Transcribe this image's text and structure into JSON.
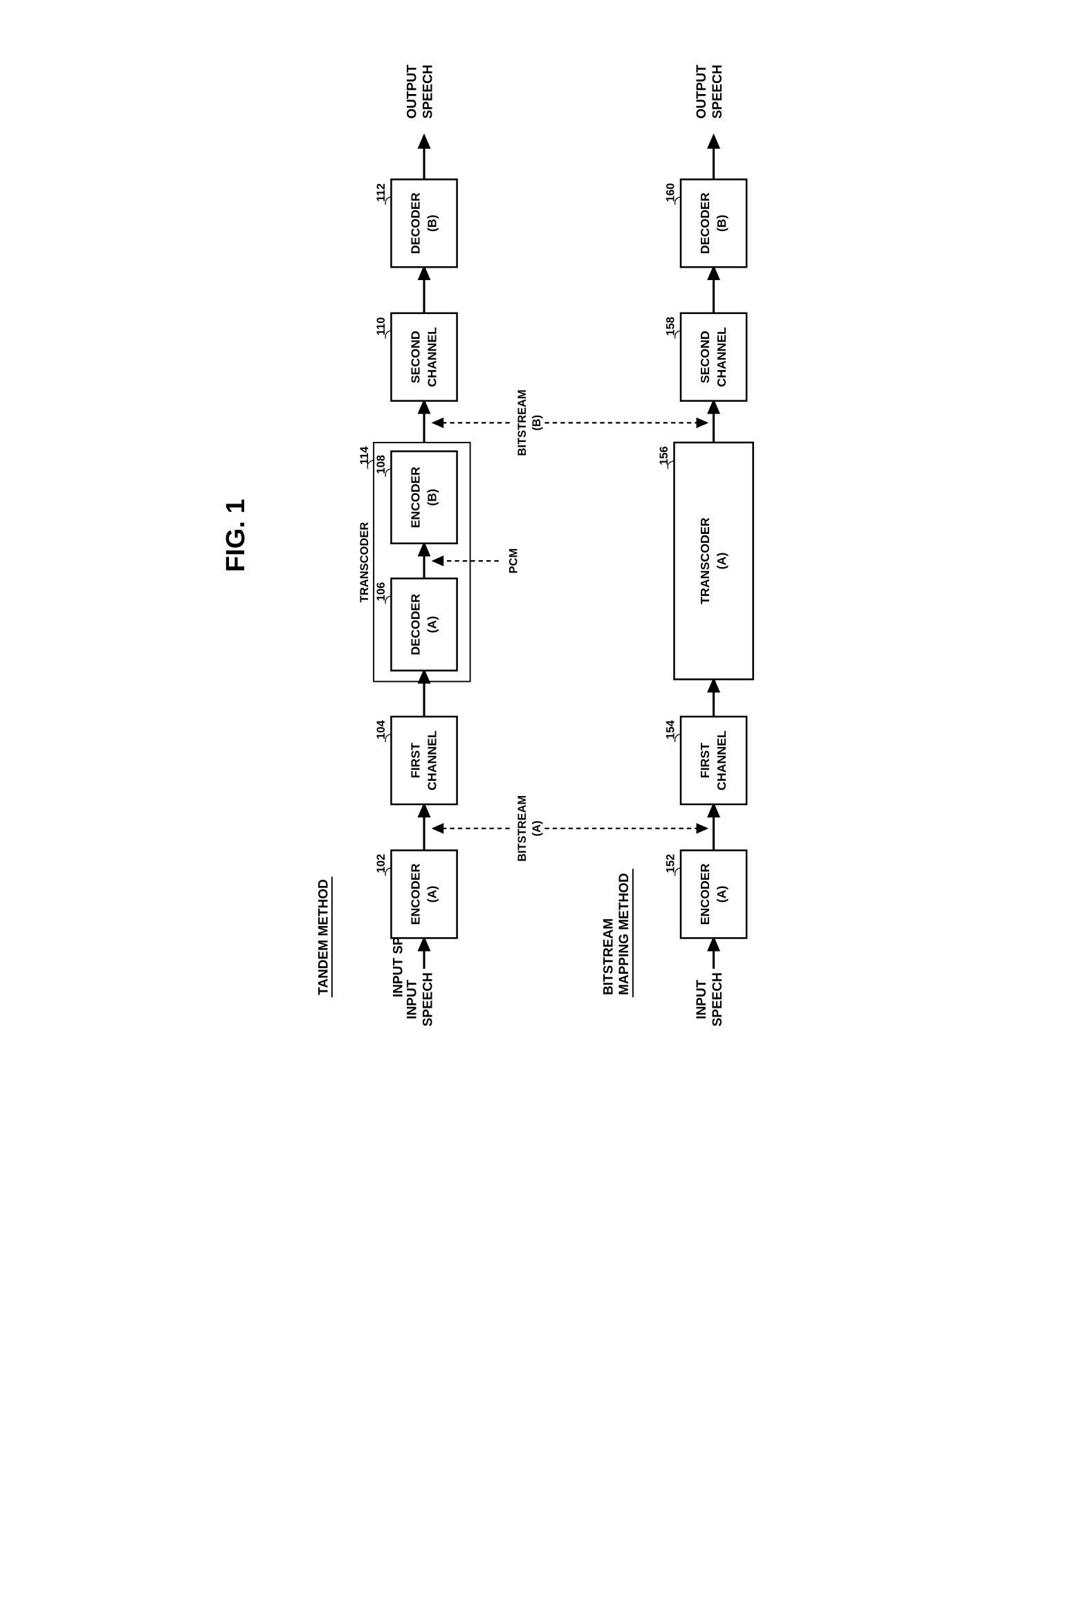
{
  "figure_title": "FIG. 1",
  "methods": {
    "tandem": {
      "label": "TANDEM METHOD",
      "input": "INPUT SPEECH",
      "output": "OUTPUT SPEECH",
      "bitstream_a": "BITSTREAM (A)",
      "pcm": "PCM",
      "bitstream_b": "BITSTREAM (B)",
      "transcoder_label": "TRANSCODER",
      "blocks": {
        "encoder_a": {
          "line1": "ENCODER",
          "line2": "(A)",
          "ref": "102"
        },
        "first_channel": {
          "line1": "FIRST",
          "line2": "CHANNEL",
          "ref": "104"
        },
        "decoder_a": {
          "line1": "DECODER",
          "line2": "(A)",
          "ref": "106"
        },
        "encoder_b": {
          "line1": "ENCODER",
          "line2": "(B)",
          "ref": "108"
        },
        "second_channel": {
          "line1": "SECOND",
          "line2": "CHANNEL",
          "ref": "110"
        },
        "decoder_b": {
          "line1": "DECODER",
          "line2": "(B)",
          "ref": "112"
        },
        "transcoder_ref": "114"
      }
    },
    "bitstream_mapping": {
      "label_line1": "BITSTREAM",
      "label_line2": "MAPPING METHOD",
      "input": "INPUT SPEECH",
      "output": "OUTPUT SPEECH",
      "blocks": {
        "encoder_a": {
          "line1": "ENCODER",
          "line2": "(A)",
          "ref": "152"
        },
        "first_channel": {
          "line1": "FIRST",
          "line2": "CHANNEL",
          "ref": "154"
        },
        "transcoder_a": {
          "line1": "TRANSCODER",
          "line2": "(A)",
          "ref": "156"
        },
        "second_channel": {
          "line1": "SECOND",
          "line2": "CHANNEL",
          "ref": "158"
        },
        "decoder_b": {
          "line1": "DECODER",
          "line2": "(B)",
          "ref": "160"
        }
      }
    }
  }
}
